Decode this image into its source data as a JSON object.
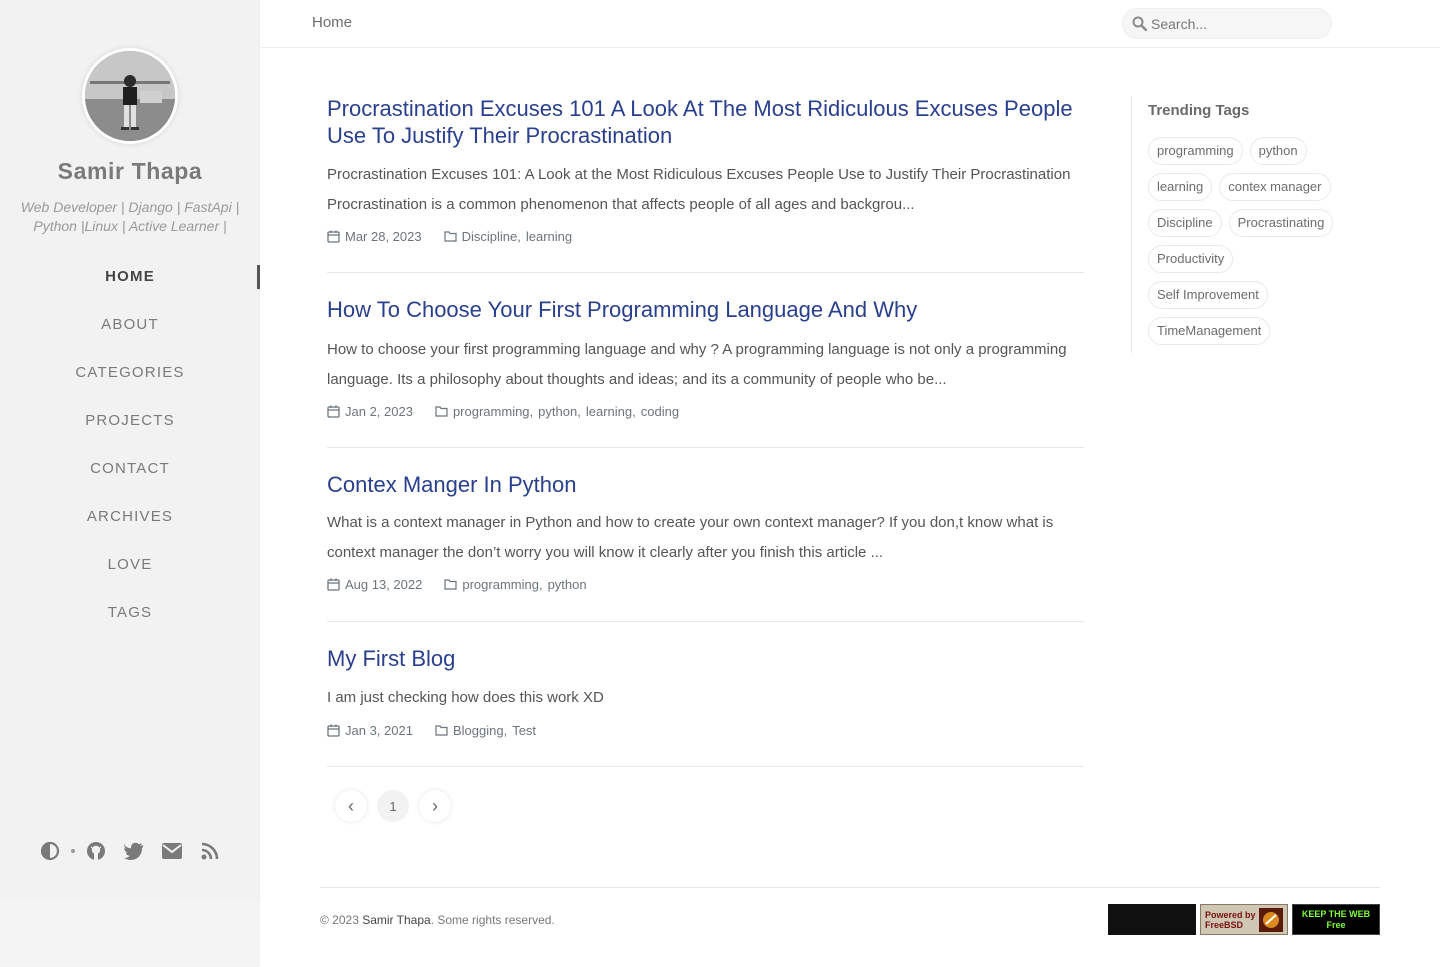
{
  "sidebar": {
    "title": "Samir Thapa",
    "subtitle": "Web Developer | Django | FastApi | Python |Linux | Active Learner |",
    "nav": [
      {
        "label": "HOME"
      },
      {
        "label": "ABOUT"
      },
      {
        "label": "CATEGORIES"
      },
      {
        "label": "PROJECTS"
      },
      {
        "label": "CONTACT"
      },
      {
        "label": "ARCHIVES"
      },
      {
        "label": "LOVE"
      },
      {
        "label": "TAGS"
      }
    ],
    "bottom_icons": [
      "theme-toggle-icon",
      "github-icon",
      "twitter-icon",
      "email-icon",
      "rss-icon"
    ]
  },
  "topbar": {
    "breadcrumb": "Home",
    "search_placeholder": "Search..."
  },
  "posts": [
    {
      "title": "Procrastination Excuses 101 A Look At The Most Ridiculous Excuses People Use To Justify Their Procrastination",
      "excerpt": "Procrastination Excuses 101: A Look at the Most Ridiculous Excuses People Use to Justify Their Procrastination Procrastination is a common phenomenon that affects people of all ages and backgrou...",
      "date": "Mar 28, 2023",
      "categories": [
        "Discipline",
        "learning"
      ]
    },
    {
      "title": "How To Choose Your First Programming Language And Why",
      "excerpt": "How to choose your first programming language and why ? A programming language is not only a programming language. Its a philosophy about thoughts and ideas; and its a community of people who be...",
      "date": "Jan 2, 2023",
      "categories": [
        "programming",
        "python",
        "learning",
        "coding"
      ]
    },
    {
      "title": "Contex Manger In Python",
      "excerpt": "What is a context manager in Python and how to create your own context manager? If you don,t know what is context manager the don’t worry you will know it clearly after you finish this article ...",
      "date": "Aug 13, 2022",
      "categories": [
        "programming",
        "python"
      ]
    },
    {
      "title": "My First Blog",
      "excerpt": "I am just checking how does this work XD",
      "date": "Jan 3, 2021",
      "categories": [
        "Blogging",
        "Test"
      ]
    }
  ],
  "pagination": {
    "prev": "‹",
    "current": "1",
    "next": "›"
  },
  "trending": {
    "title": "Trending Tags",
    "tags": [
      "programming",
      "python",
      "learning",
      "contex manager",
      "Discipline",
      "Procrastinating",
      "Productivity",
      "Self Improvement",
      "TimeManagement"
    ]
  },
  "footer": {
    "copyright_prefix": "© 2023",
    "author": "Samir Thapa",
    "suffix": ". Some rights reserved.",
    "badges": [
      {
        "text": "",
        "bg": "#111111"
      },
      {
        "text": "Powered by FreeBSD",
        "bg": "#c8c0b0"
      },
      {
        "text": "KEEP THE WEB Free",
        "bg": "#000000"
      }
    ]
  },
  "colors": {
    "post_title": "#2a408e",
    "sidebar_bg": "#f2f2f2"
  }
}
